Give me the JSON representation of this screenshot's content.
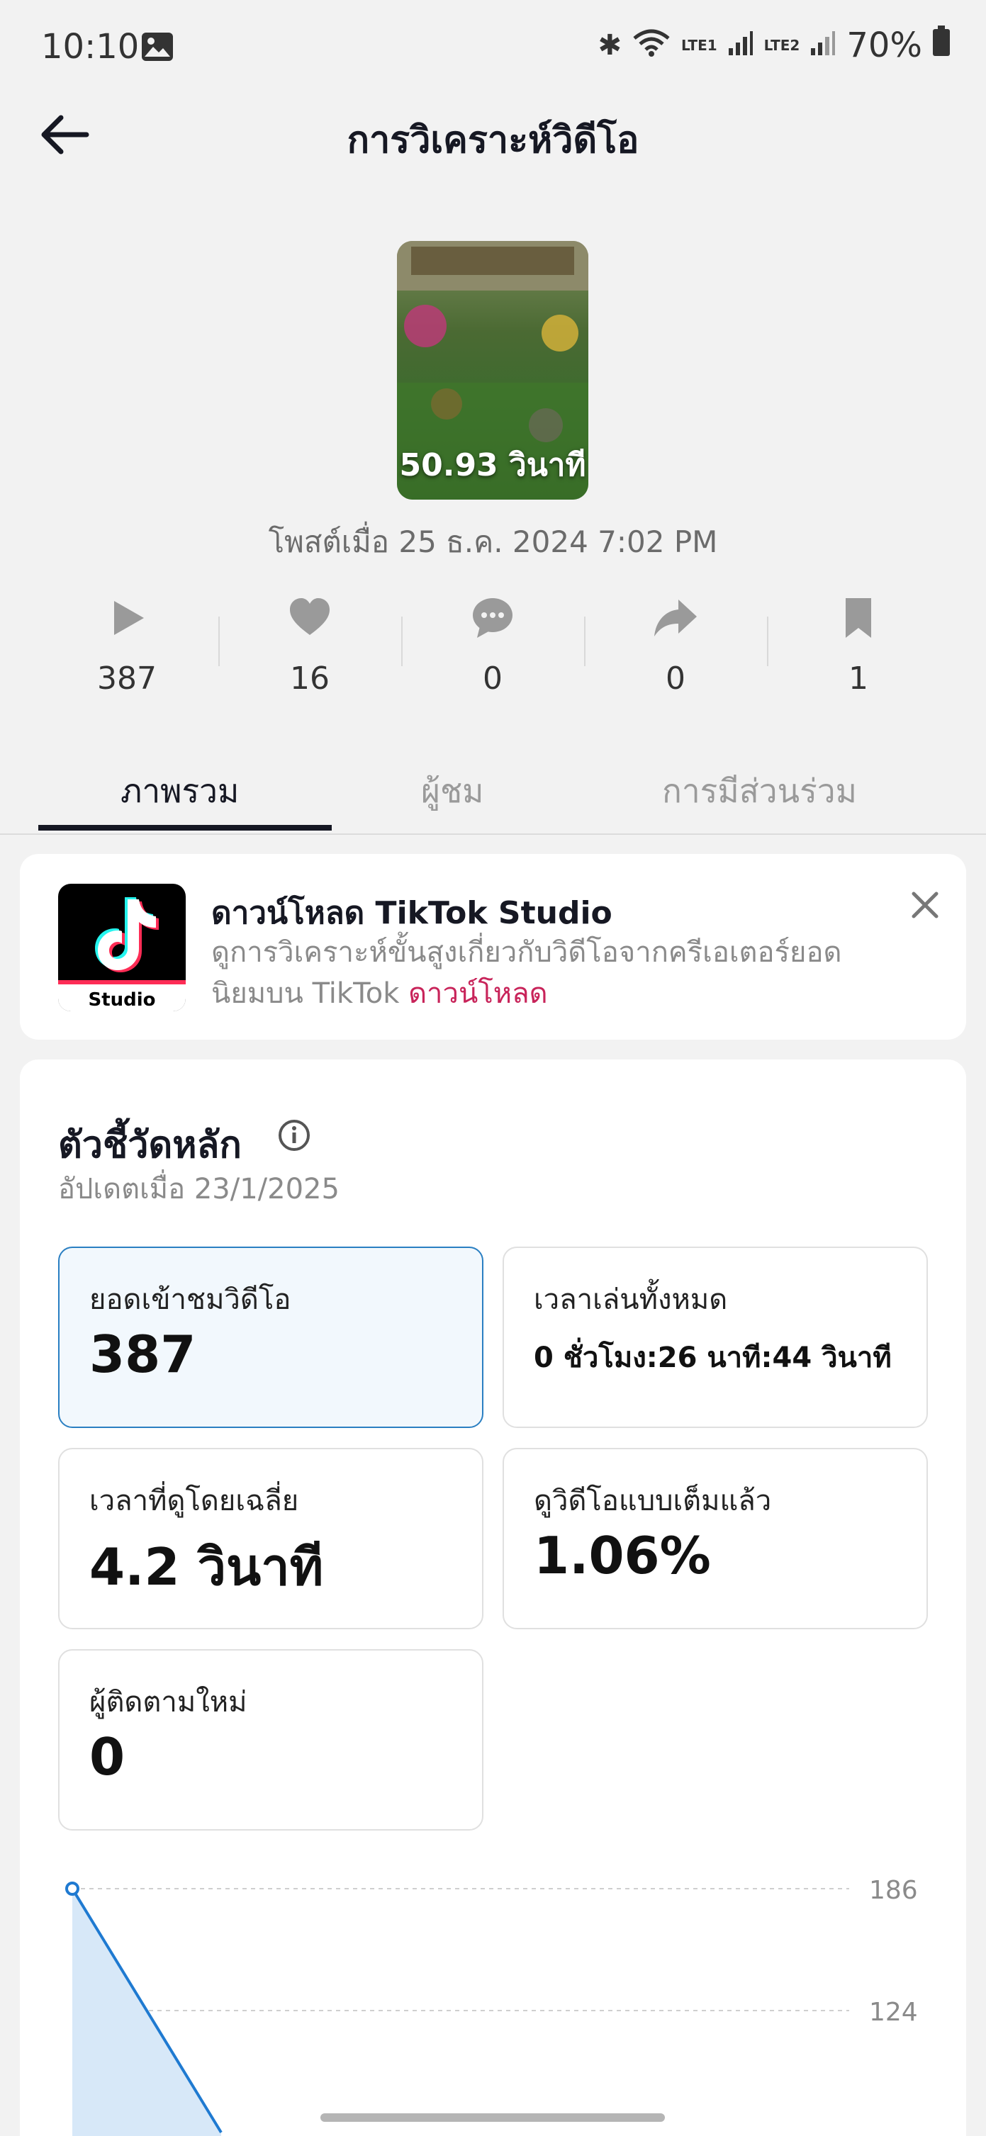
{
  "status_bar": {
    "time": "10:10",
    "network_1": "LTE1",
    "network_2": "LTE2",
    "battery": "70%"
  },
  "header": {
    "title": "การวิเคราะห์วิดีโอ"
  },
  "video": {
    "duration": "50.93 วินาที",
    "posted": "โพสต์เมื่อ 25 ธ.ค. 2024 7:02 PM"
  },
  "stats": {
    "views": "387",
    "likes": "16",
    "comments": "0",
    "shares": "0",
    "saves": "1"
  },
  "tabs": [
    {
      "label": "ภาพรวม",
      "active": true
    },
    {
      "label": "ผู้ชม",
      "active": false
    },
    {
      "label": "การมีส่วนร่วม",
      "active": false
    }
  ],
  "banner": {
    "logo_text": "Studio",
    "title": "ดาวน์โหลด TikTok Studio",
    "desc": "ดูการวิเคราะห์ขั้นสูงเกี่ยวกับวิดีโอจากครีเอเตอร์ยอดนิยมบน TikTok",
    "link": "ดาวน์โหลด"
  },
  "metrics": {
    "title": "ตัวชี้วัดหลัก",
    "updated": "อัปเดตเมื่อ 23/1/2025",
    "tiles": [
      {
        "label": "ยอดเข้าชมวิดีโอ",
        "value": "387",
        "selected": true
      },
      {
        "label": "เวลาเล่นทั้งหมด",
        "value": "0 ชั่วโมง:26 นาที:44 วินาที",
        "selected": false
      },
      {
        "label": "เวลาที่ดูโดยเฉลี่ย",
        "value": "4.2 วินาที",
        "selected": false
      },
      {
        "label": "ดูวิดีโอแบบเต็มแล้ว",
        "value": "1.06%",
        "selected": false
      },
      {
        "label": "ผู้ติดตามใหม่",
        "value": "0",
        "selected": false
      }
    ]
  },
  "chart_data": {
    "type": "area",
    "y_ticks": [
      "186",
      "124"
    ],
    "y_tick_values": [
      186,
      124
    ],
    "series": [
      {
        "values": [
          186,
          62
        ]
      }
    ],
    "grid": true
  },
  "colors": {
    "accent": "#2a7fc2",
    "link": "#c8245a",
    "tiktok_red": "#fe2c55"
  }
}
